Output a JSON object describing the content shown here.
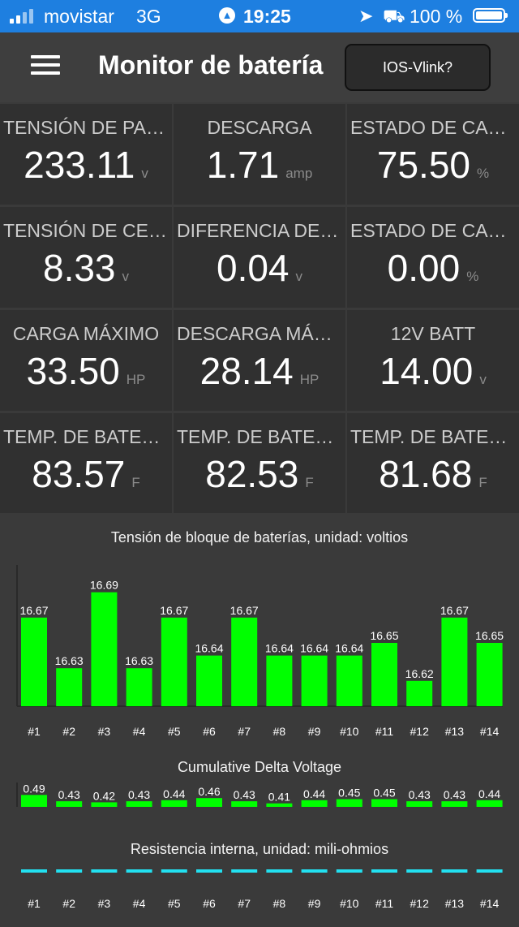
{
  "status_bar": {
    "carrier": "movistar",
    "network": "3G",
    "time": "19:25",
    "battery_pct": "100 %"
  },
  "header": {
    "title": "Monitor de batería",
    "device_button": "IOS-Vlink?"
  },
  "tiles": [
    {
      "label": "TENSIÓN DE PAQUETE",
      "value": "233.11",
      "unit": "v"
    },
    {
      "label": "DESCARGA",
      "value": "1.71",
      "unit": "amp"
    },
    {
      "label": "ESTADO DE CARGA",
      "value": "75.50",
      "unit": "%"
    },
    {
      "label": "TENSIÓN DE CELDA",
      "value": "8.33",
      "unit": "v"
    },
    {
      "label": "DIFERENCIA DE TENSIÓN",
      "value": "0.04",
      "unit": "v"
    },
    {
      "label": "ESTADO DE CARGA",
      "value": "0.00",
      "unit": "%"
    },
    {
      "label": "CARGA MÁXIMO",
      "value": "33.50",
      "unit": "HP"
    },
    {
      "label": "DESCARGA MÁXIMO",
      "value": "28.14",
      "unit": "HP"
    },
    {
      "label": "12V BATT",
      "value": "14.00",
      "unit": "v"
    },
    {
      "label": "TEMP. DE BATERÍA",
      "value": "83.57",
      "unit": "F"
    },
    {
      "label": "TEMP. DE BATERÍA",
      "value": "82.53",
      "unit": "F"
    },
    {
      "label": "TEMP. DE BATERÍA",
      "value": "81.68",
      "unit": "F"
    }
  ],
  "colors": {
    "bar": "#00ff00",
    "resistance": "#22e0f0",
    "status_bar": "#1e7fe0"
  },
  "chart_data": [
    {
      "type": "bar",
      "title": "Tensión de bloque de baterías, unidad: voltios",
      "categories": [
        "#1",
        "#2",
        "#3",
        "#4",
        "#5",
        "#6",
        "#7",
        "#8",
        "#9",
        "#10",
        "#11",
        "#12",
        "#13",
        "#14"
      ],
      "values": [
        16.67,
        16.63,
        16.69,
        16.63,
        16.67,
        16.64,
        16.67,
        16.64,
        16.64,
        16.64,
        16.65,
        16.62,
        16.67,
        16.65
      ],
      "ylim": [
        16.6,
        16.7
      ]
    },
    {
      "type": "bar",
      "title": "Cumulative Delta Voltage",
      "categories": [
        "#1",
        "#2",
        "#3",
        "#4",
        "#5",
        "#6",
        "#7",
        "#8",
        "#9",
        "#10",
        "#11",
        "#12",
        "#13",
        "#14"
      ],
      "values": [
        0.49,
        0.43,
        0.42,
        0.43,
        0.44,
        0.46,
        0.43,
        0.41,
        0.44,
        0.45,
        0.45,
        0.43,
        0.43,
        0.44
      ],
      "ylim": [
        0.4,
        0.5
      ]
    },
    {
      "type": "bar",
      "title": "Resistencia interna, unidad: mili-ohmios",
      "categories": [
        "#1",
        "#2",
        "#3",
        "#4",
        "#5",
        "#6",
        "#7",
        "#8",
        "#9",
        "#10",
        "#11",
        "#12",
        "#13",
        "#14"
      ],
      "values": []
    }
  ]
}
